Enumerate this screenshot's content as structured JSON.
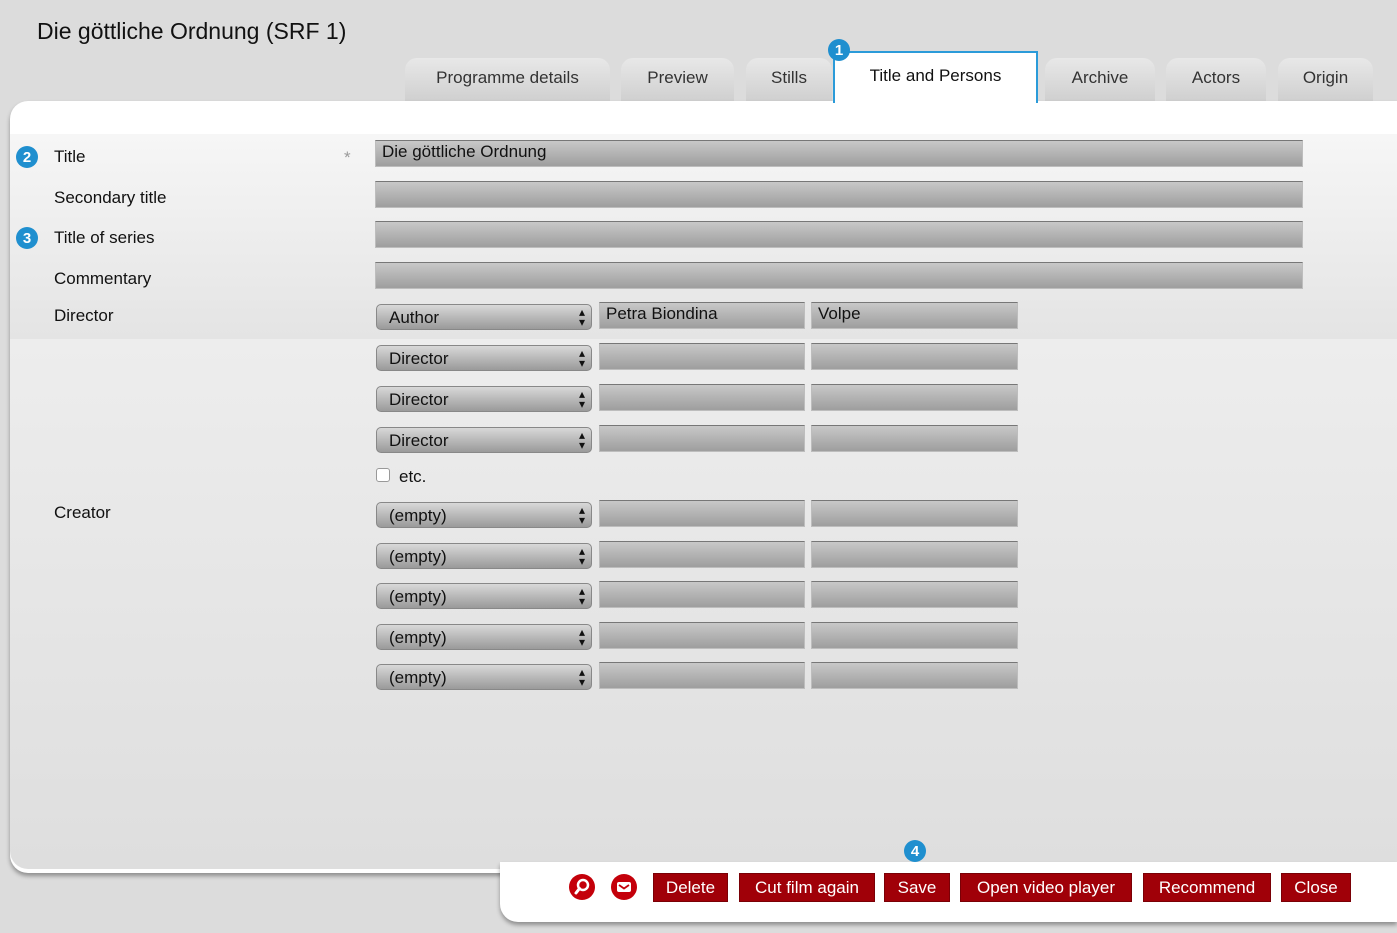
{
  "window": {
    "title": "Die göttliche Ordnung (SRF 1)"
  },
  "tabs": [
    {
      "label": "Programme details",
      "active": false
    },
    {
      "label": "Preview",
      "active": false
    },
    {
      "label": "Stills",
      "active": false
    },
    {
      "label": "Title and Persons",
      "active": true
    },
    {
      "label": "Archive",
      "active": false
    },
    {
      "label": "Actors",
      "active": false
    },
    {
      "label": "Origin",
      "active": false
    }
  ],
  "badges": [
    "1",
    "2",
    "3",
    "4"
  ],
  "form": {
    "required_mark": "*",
    "title": {
      "label": "Title",
      "value": "Die göttliche Ordnung"
    },
    "secondary_title": {
      "label": "Secondary title",
      "value": ""
    },
    "title_of_series": {
      "label": "Title of series",
      "value": ""
    },
    "commentary": {
      "label": "Commentary",
      "value": ""
    },
    "director": {
      "label": "Director",
      "rows": [
        {
          "role": "Author",
          "first_name": "Petra Biondina",
          "last_name": "Volpe"
        },
        {
          "role": "Director",
          "first_name": "",
          "last_name": ""
        },
        {
          "role": "Director",
          "first_name": "",
          "last_name": ""
        },
        {
          "role": "Director",
          "first_name": "",
          "last_name": ""
        }
      ],
      "etc_label": "etc.",
      "etc_checked": false
    },
    "creator": {
      "label": "Creator",
      "rows": [
        {
          "role": "(empty)",
          "first_name": "",
          "last_name": ""
        },
        {
          "role": "(empty)",
          "first_name": "",
          "last_name": ""
        },
        {
          "role": "(empty)",
          "first_name": "",
          "last_name": ""
        },
        {
          "role": "(empty)",
          "first_name": "",
          "last_name": ""
        },
        {
          "role": "(empty)",
          "first_name": "",
          "last_name": ""
        }
      ]
    }
  },
  "footer": {
    "icons": [
      "search-icon",
      "mail-icon"
    ],
    "buttons": {
      "delete": "Delete",
      "cut_film_again": "Cut film again",
      "save": "Save",
      "open_video_player": "Open video player",
      "recommend": "Recommend",
      "close": "Close"
    },
    "accent_color": "#a00008"
  },
  "colors": {
    "tab_highlight": "#2b9bd9",
    "badge": "#1f8fcf"
  }
}
